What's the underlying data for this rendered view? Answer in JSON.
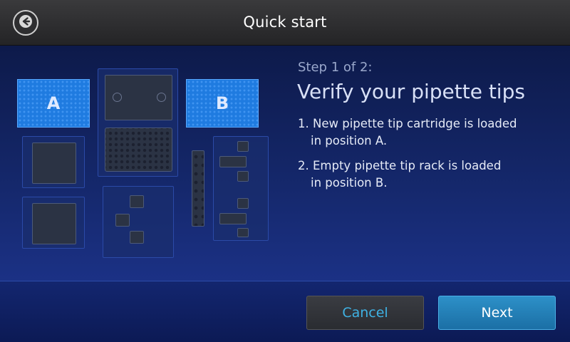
{
  "header": {
    "title": "Quick start",
    "back_icon": "arrow-left-icon"
  },
  "deck": {
    "position_a_label": "A",
    "position_b_label": "B"
  },
  "content": {
    "step": "Step 1 of 2:",
    "title": "Verify your pipette tips",
    "instructions": [
      {
        "line1": "1. New pipette tip cartridge is loaded",
        "line2": "in position A."
      },
      {
        "line1": "2. Empty pipette tip rack is loaded",
        "line2": "in position B."
      }
    ]
  },
  "footer": {
    "cancel_label": "Cancel",
    "next_label": "Next"
  },
  "colors": {
    "accent": "#3fb2e4",
    "primary_button": "#2384bb",
    "tile_highlight": "#1f7be0"
  }
}
